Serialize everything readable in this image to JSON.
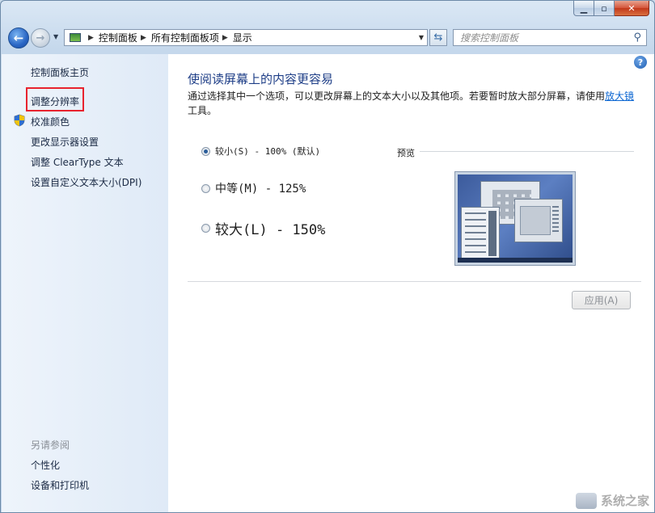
{
  "window": {
    "caption": {
      "minimize": "▁",
      "maximize": "▫",
      "close": "✕"
    }
  },
  "addressbar": {
    "back_icon": "back-arrow-icon",
    "forward_icon": "forward-arrow-icon",
    "breadcrumb": [
      "控制面板",
      "所有控制面板项",
      "显示"
    ],
    "search_placeholder": "搜索控制面板"
  },
  "sidebar": {
    "items": [
      {
        "label": "控制面板主页"
      },
      {
        "label": "调整分辨率",
        "highlighted": true
      },
      {
        "label": "校准颜色",
        "icon": "uac-shield-icon"
      },
      {
        "label": "更改显示器设置"
      },
      {
        "label": "调整 ClearType 文本"
      },
      {
        "label": "设置自定义文本大小(DPI)"
      }
    ],
    "see_also": {
      "heading": "另请参阅",
      "links": [
        "个性化",
        "设备和打印机"
      ]
    }
  },
  "main": {
    "title": "使阅读屏幕上的内容更容易",
    "description_before_link": "通过选择其中一个选项，可以更改屏幕上的文本大小以及其他项。若要暂时放大部分屏幕，请使用",
    "description_link": "放大镜",
    "description_after_link": "工具。",
    "options": [
      {
        "label": "较小(S) - 100% (默认)",
        "checked": true
      },
      {
        "label": "中等(M) - 125%",
        "checked": false
      },
      {
        "label": "较大(L) - 150%",
        "checked": false
      }
    ],
    "preview_label": "预览",
    "apply_label": "应用(A)",
    "apply_enabled": false
  },
  "watermark": {
    "text": "系统之家"
  },
  "colors": {
    "highlight_border": "#e8232e",
    "title_blue": "#1e3e87",
    "link_blue": "#0b66d2",
    "sidebar_bg": "#e6eef8"
  }
}
